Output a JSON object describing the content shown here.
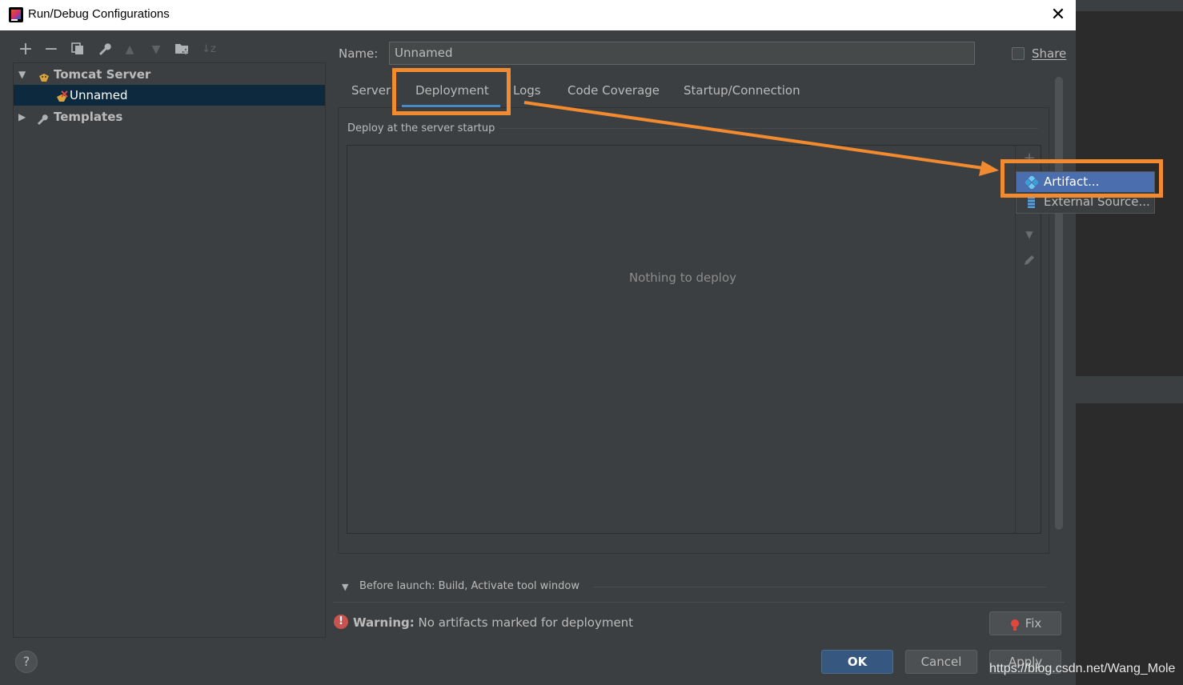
{
  "window": {
    "title": "Run/Debug Configurations",
    "close": "✕"
  },
  "toolbar": {
    "add": "+",
    "remove": "−",
    "copy": "⧉",
    "edit": "🔧",
    "up": "▲",
    "down": "▼",
    "folder": "📁",
    "sort": "↓z"
  },
  "tree": {
    "items": [
      {
        "label": "Tomcat Server",
        "expanded": true,
        "icon": "tomcat-icon"
      },
      {
        "label": "Unnamed",
        "selected": true,
        "icon": "tomcat-config-icon"
      },
      {
        "label": "Templates",
        "expanded": false,
        "icon": "wrench-icon"
      }
    ]
  },
  "name_field": {
    "label": "Name:",
    "value": "Unnamed"
  },
  "share": {
    "label": "Share",
    "checked": false
  },
  "tabs": [
    {
      "label": "Server"
    },
    {
      "label": "Deployment",
      "active": true
    },
    {
      "label": "Logs"
    },
    {
      "label": "Code Coverage"
    },
    {
      "label": "Startup/Connection"
    }
  ],
  "deployment": {
    "caption": "Deploy at the server startup",
    "empty_text": "Nothing to deploy"
  },
  "popup_menu": {
    "items": [
      {
        "label": "Artifact...",
        "icon": "artifact-icon",
        "highlighted": true
      },
      {
        "label": "External Source...",
        "icon": "external-source-icon"
      }
    ]
  },
  "before_launch": {
    "label": "Before launch: Build, Activate tool window"
  },
  "warning": {
    "bold": "Warning:",
    "text": "No artifacts marked for deployment"
  },
  "buttons": {
    "fix": "Fix",
    "ok": "OK",
    "cancel": "Cancel",
    "apply": "Apply",
    "help": "?"
  },
  "colors": {
    "annotation": "#f28a30",
    "selection": "#0d293e",
    "menu_highlight": "#4b6eaf",
    "tab_underline": "#4a88c7"
  },
  "watermark": "https://blog.csdn.net/Wang_Mole"
}
